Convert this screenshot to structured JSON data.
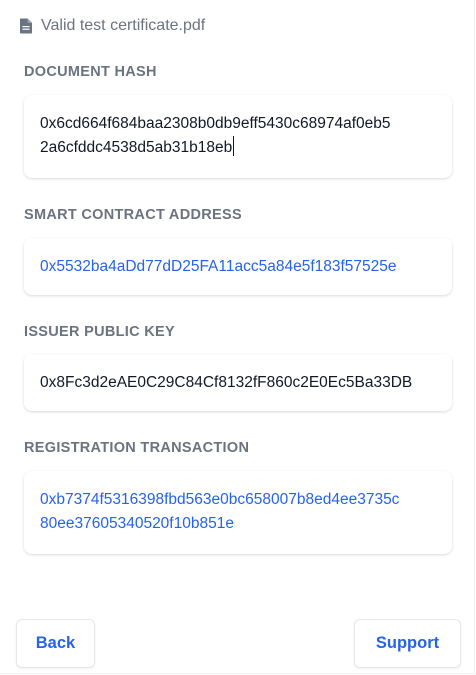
{
  "file": {
    "name": "Valid test certificate.pdf",
    "icon": "document-icon"
  },
  "fields": {
    "document_hash": {
      "label": "DOCUMENT HASH",
      "value_line1": "0x6cd664f684baa2308b0db9eff5430c68974af0eb5",
      "value_line2": "2a6cfddc4538d5ab31b18eb"
    },
    "smart_contract_address": {
      "label": "SMART CONTRACT ADDRESS",
      "value": "0x5532ba4aDd77dD25FA11acc5a84e5f183f57525e"
    },
    "issuer_public_key": {
      "label": "ISSUER PUBLIC KEY",
      "value": "0x8Fc3d2eAE0C29C84Cf8132fF860c2E0Ec5Ba33DB"
    },
    "registration_transaction": {
      "label": "REGISTRATION TRANSACTION",
      "value_line1": "0xb7374f5316398fbd563e0bc658007b8ed4ee3735c",
      "value_line2": "80ee37605340520f10b851e"
    }
  },
  "buttons": {
    "back_label": "Back",
    "support_label": "Support"
  },
  "colors": {
    "accent": "#2563eb",
    "label": "#6b7280",
    "text": "#111827"
  }
}
